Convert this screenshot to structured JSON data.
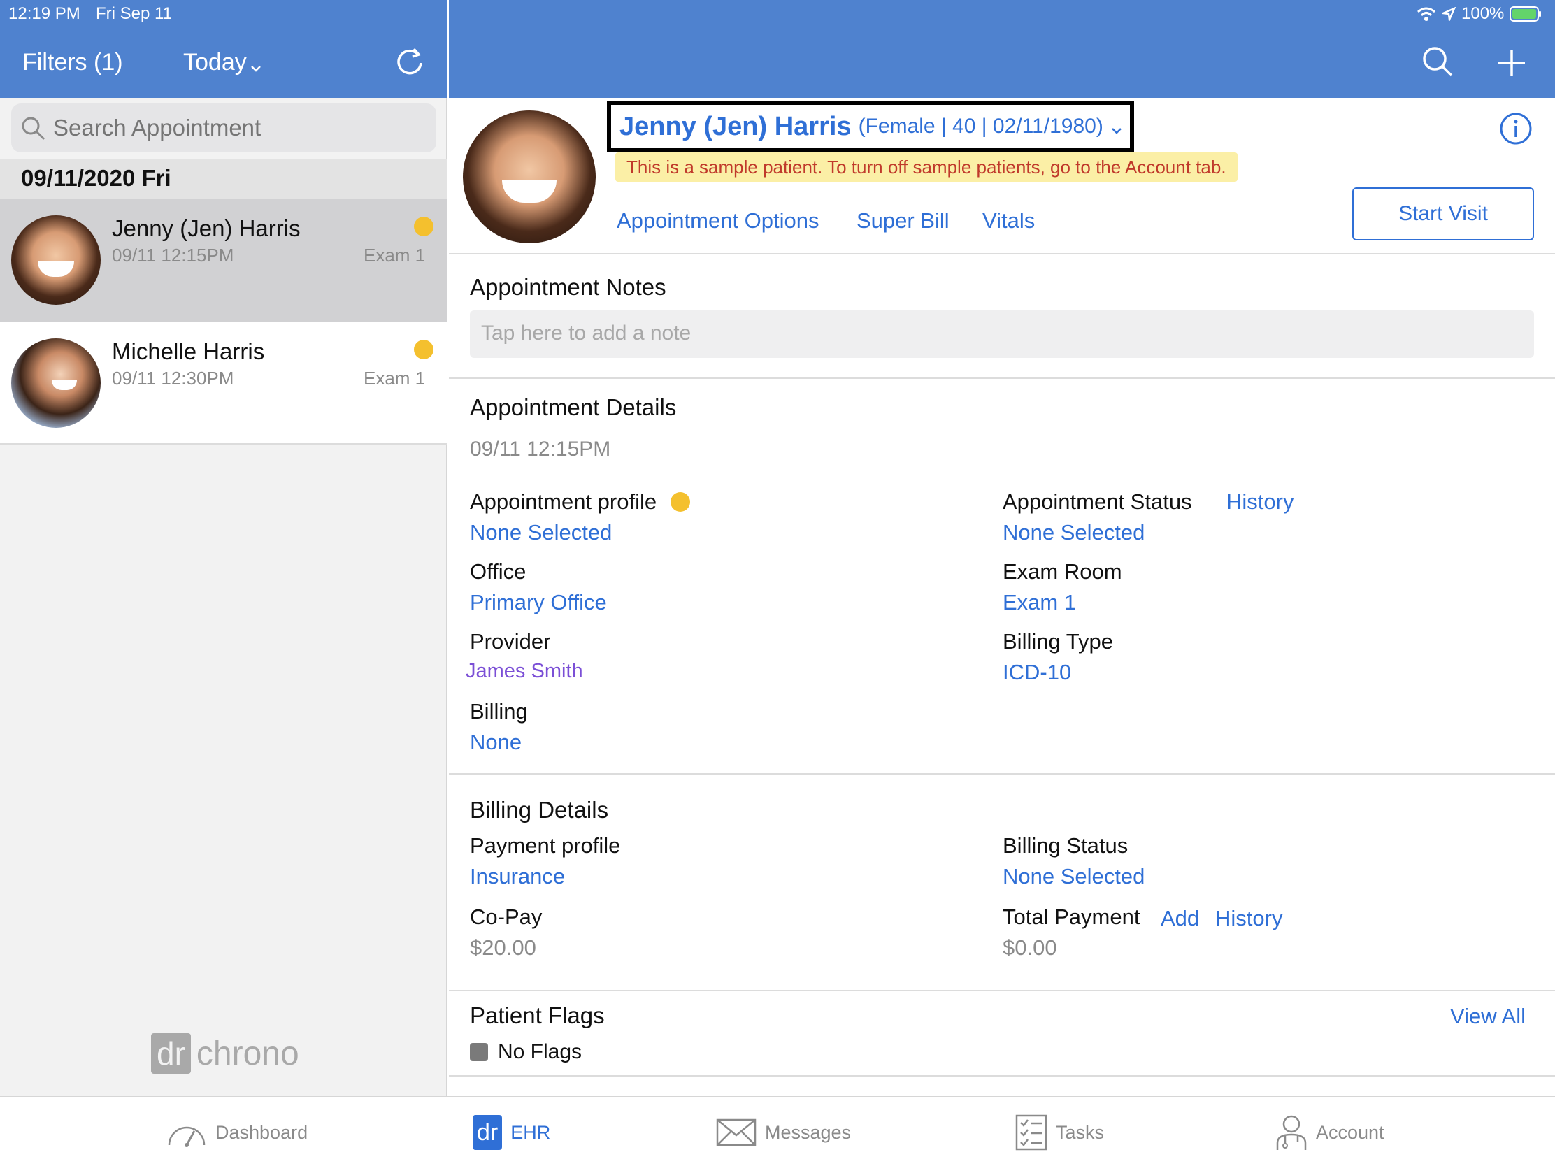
{
  "status_bar": {
    "time": "12:19 PM",
    "date": "Fri Sep 11",
    "battery": "100%"
  },
  "toolbar": {
    "filters_label": "Filters (1)",
    "today_label": "Today"
  },
  "search": {
    "placeholder": "Search Appointment"
  },
  "sidebar": {
    "date_header": "09/11/2020 Fri",
    "appointments": [
      {
        "name": "Jenny (Jen) Harris",
        "time": "09/11 12:15PM",
        "room": "Exam 1",
        "status_color": "#f4c02e"
      },
      {
        "name": "Michelle Harris",
        "time": "09/11 12:30PM",
        "room": "Exam 1",
        "status_color": "#f4c02e"
      }
    ],
    "logo_dr": "dr",
    "logo_text": "chrono"
  },
  "patient": {
    "name": "Jenny (Jen) Harris",
    "details": "(Female | 40 | 02/11/1980)",
    "sample_notice": "This is a sample patient. To turn off sample patients, go to the Account tab.",
    "actions": [
      "Appointment Options",
      "Super Bill",
      "Vitals"
    ],
    "start_visit": "Start Visit"
  },
  "appointment_notes": {
    "title": "Appointment Notes",
    "placeholder": "Tap here to add a note"
  },
  "appointment_details": {
    "title": "Appointment Details",
    "datetime": "09/11 12:15PM",
    "profile_label": "Appointment profile",
    "profile_value": "None Selected",
    "status_label": "Appointment Status",
    "status_history": "History",
    "status_value": "None Selected",
    "office_label": "Office",
    "office_value": "Primary Office",
    "exam_room_label": "Exam Room",
    "exam_room_value": "Exam 1",
    "provider_label": "Provider",
    "provider_value": "James Smith",
    "billing_type_label": "Billing Type",
    "billing_type_value": "ICD-10",
    "billing_label": "Billing",
    "billing_value": "None"
  },
  "billing_details": {
    "title": "Billing Details",
    "payment_profile_label": "Payment profile",
    "payment_profile_value": "Insurance",
    "billing_status_label": "Billing Status",
    "billing_status_value": "None Selected",
    "copay_label": "Co-Pay",
    "copay_value": "$20.00",
    "total_payment_label": "Total Payment",
    "total_payment_add": "Add",
    "total_payment_history": "History",
    "total_payment_value": "$0.00"
  },
  "patient_flags": {
    "title": "Patient Flags",
    "view_all": "View All",
    "no_flags": "No Flags"
  },
  "tabs": [
    {
      "label": "Dashboard",
      "icon": "gauge-icon"
    },
    {
      "label": "EHR",
      "icon": "dr-logo-icon"
    },
    {
      "label": "Messages",
      "icon": "envelope-icon"
    },
    {
      "label": "Tasks",
      "icon": "checklist-icon"
    },
    {
      "label": "Account",
      "icon": "user-icon"
    }
  ],
  "colors": {
    "brand_blue": "#4f82cf",
    "link_blue": "#2f6fd6",
    "provider_purple": "#7b4fd6",
    "status_yellow": "#f4c02e",
    "notice_bg": "#fbefa6",
    "notice_text": "#c0392b"
  }
}
